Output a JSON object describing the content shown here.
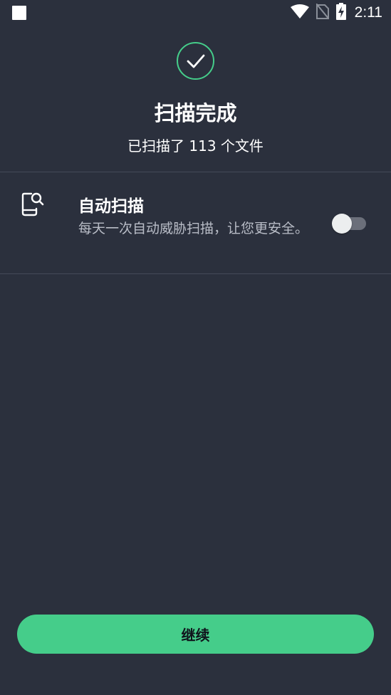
{
  "status_bar": {
    "time": "2:11",
    "icons": [
      "app-notification-icon",
      "wifi-icon",
      "no-sim-icon",
      "battery-charging-icon"
    ]
  },
  "header": {
    "icon": "check-circle-icon",
    "title": "扫描完成",
    "subtitle": "已扫描了 113 个文件"
  },
  "auto_scan": {
    "icon": "phone-search-icon",
    "title": "自动扫描",
    "description": "每天一次自动威胁扫描，让您更安全。",
    "enabled": false
  },
  "continue_button": {
    "label": "继续"
  },
  "colors": {
    "background": "#2b303d",
    "accent": "#45cd8a",
    "text_primary": "#ffffff",
    "text_secondary": "#b9bdc7",
    "divider": "#444a58",
    "toggle_track": "#6b6f7a"
  }
}
